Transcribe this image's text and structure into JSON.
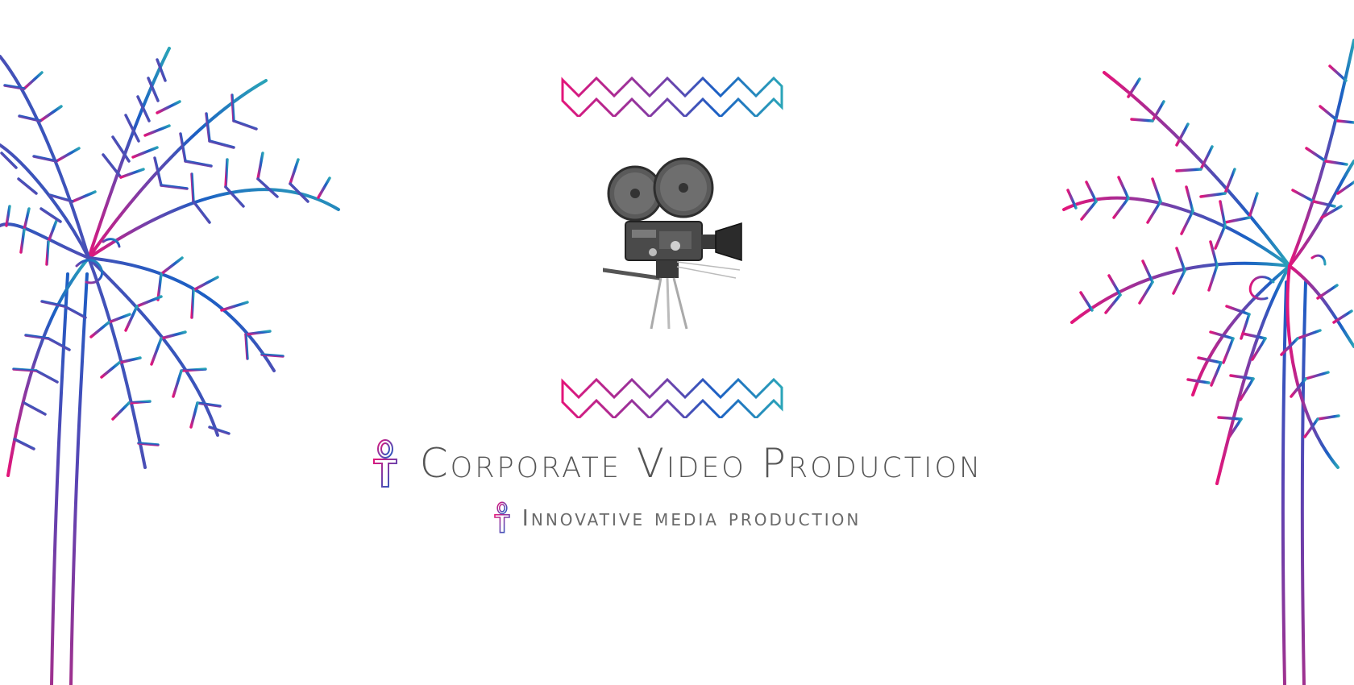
{
  "hero": {
    "title": "Corporate Video Production",
    "subtitle": "Innovative media production"
  },
  "icons": {
    "title_icon": "ankh-icon",
    "subtitle_icon": "ankh-icon",
    "camera": "film-camera-icon",
    "left_decoration": "palm-tree-icon",
    "right_decoration": "palm-tree-icon",
    "divider": "zigzag-divider"
  },
  "colors": {
    "gradient_pink": "#e3157a",
    "gradient_purple": "#7a3ea8",
    "gradient_blue": "#1c5fc4",
    "gradient_teal": "#2aa4b8",
    "text_primary": "#555555",
    "text_secondary": "#6a6a6a",
    "background": "#ffffff"
  }
}
